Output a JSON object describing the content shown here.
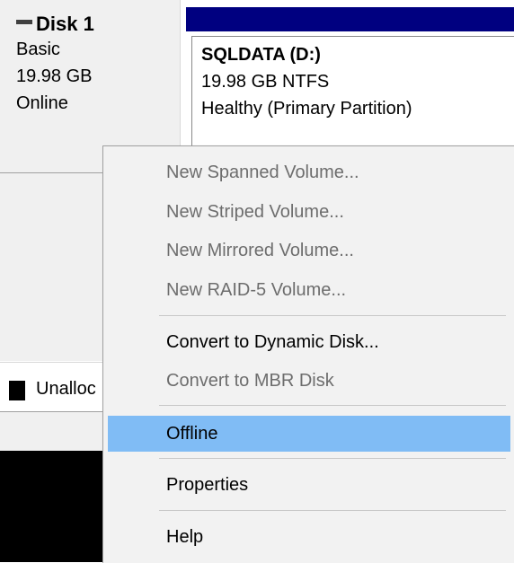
{
  "disk": {
    "name": "Disk 1",
    "type": "Basic",
    "size": "19.98 GB",
    "status": "Online"
  },
  "partition": {
    "name": "SQLDATA  (D:)",
    "size_fs": "19.98 GB NTFS",
    "health": "Healthy (Primary Partition)"
  },
  "legend": {
    "unallocated_label": "Unalloc"
  },
  "context_menu": {
    "items": [
      {
        "label": "New Spanned Volume...",
        "enabled": false
      },
      {
        "label": "New Striped Volume...",
        "enabled": false
      },
      {
        "label": "New Mirrored Volume...",
        "enabled": false
      },
      {
        "label": "New RAID-5 Volume...",
        "enabled": false
      },
      {
        "label": "Convert to Dynamic Disk...",
        "enabled": true
      },
      {
        "label": "Convert to MBR Disk",
        "enabled": false
      },
      {
        "label": "Offline",
        "enabled": true,
        "highlighted": true
      },
      {
        "label": "Properties",
        "enabled": true
      },
      {
        "label": "Help",
        "enabled": true
      }
    ]
  },
  "colors": {
    "partition_bar": "#000080",
    "menu_highlight": "#80bcf5",
    "menu_background": "#f2f2f2",
    "disabled_text": "#6d6d6d"
  }
}
